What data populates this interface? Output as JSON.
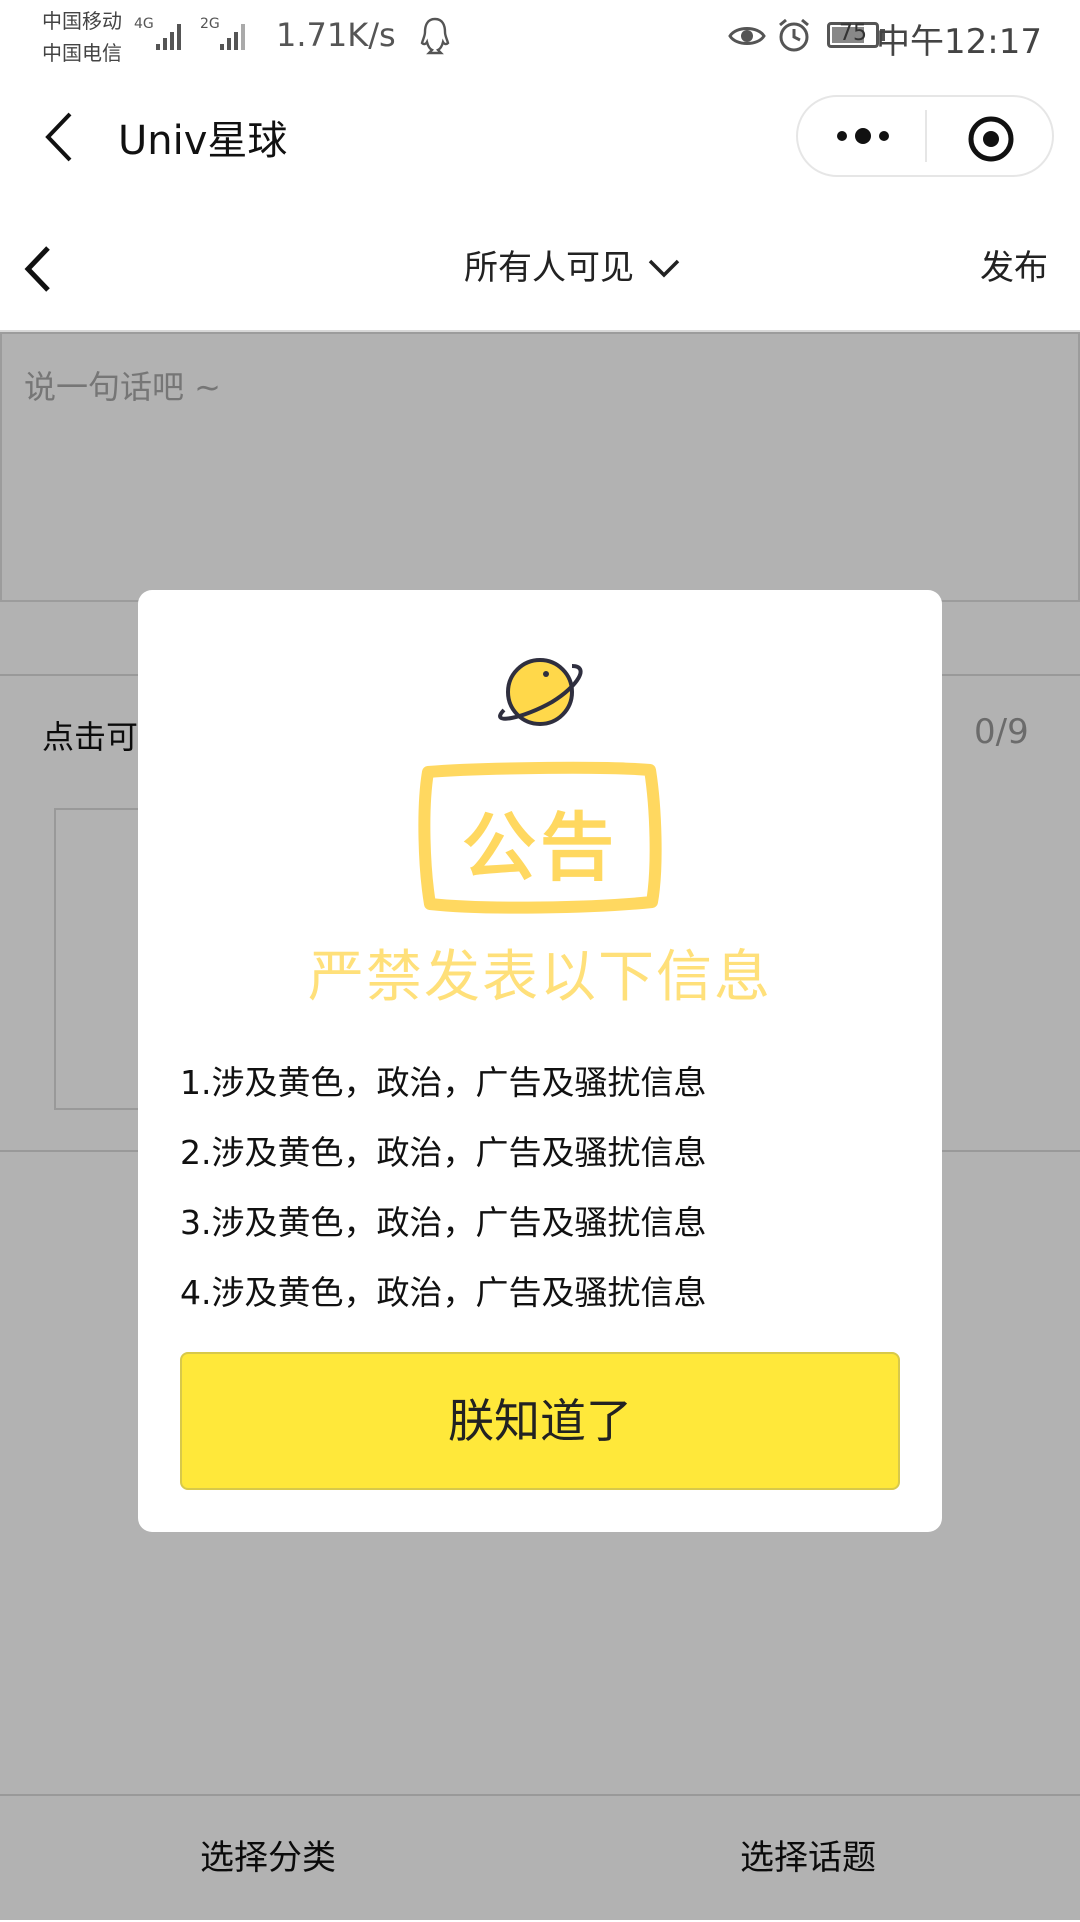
{
  "status_bar": {
    "carrier1": "中国移动",
    "carrier2": "中国电信",
    "net1": "4G",
    "net2": "2G",
    "speed": "1.71K/s",
    "battery": "75",
    "battery_level": 0.75,
    "time": "中午12:17",
    "icons": [
      "signal-icon",
      "qq-icon",
      "eye-icon",
      "alarm-icon",
      "battery-icon"
    ]
  },
  "mini_nav": {
    "title": "Univ星球",
    "icons": [
      "back-icon",
      "more-icon",
      "close-target-icon"
    ]
  },
  "editor_header": {
    "visibility": "所有人可见",
    "publish": "发布",
    "icons": [
      "back-icon",
      "chevron-down-icon"
    ]
  },
  "editor": {
    "placeholder": "说一句话吧 ~",
    "upload_label": "点击可",
    "count": "0/9"
  },
  "bottom_bar": {
    "category": "选择分类",
    "topic": "选择话题"
  },
  "dialog": {
    "stamp": "公告",
    "subtitle": "严禁发表以下信息",
    "rules": [
      "1.涉及黄色，政治，广告及骚扰信息",
      "2.涉及黄色，政治，广告及骚扰信息",
      "3.涉及黄色，政治，广告及骚扰信息",
      "4.涉及黄色，政治，广告及骚扰信息"
    ],
    "confirm": "朕知道了",
    "accent_color": "#ffe83a",
    "stamp_color": "#ffd860"
  }
}
